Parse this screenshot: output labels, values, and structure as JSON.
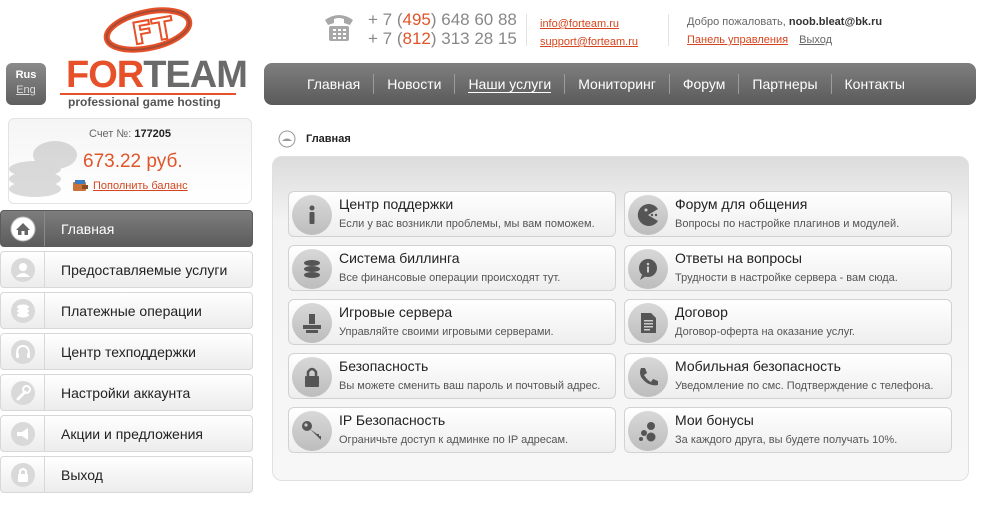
{
  "header": {
    "phones": [
      {
        "prefix": "+ 7 (",
        "code": "495",
        "suffix": ") 648 60 88"
      },
      {
        "prefix": "+ 7 (",
        "code": "812",
        "suffix": ") 313 28 15"
      }
    ],
    "emails": [
      "info@forteam.ru",
      "support@forteam.ru"
    ],
    "welcome": "Добро пожаловать,",
    "user": "noob.bleat@bk.ru",
    "panel_link": "Панель управления",
    "exit_link": "Выход"
  },
  "lang": {
    "active": "Rus",
    "other": "Eng"
  },
  "logo": {
    "part1": "FOR",
    "part2": "TEAM",
    "tagline": "professional game hosting",
    "mark": "FT"
  },
  "nav": {
    "items": [
      "Главная",
      "Новости",
      "Наши услуги",
      "Мониторинг",
      "Форум",
      "Партнеры",
      "Контакты"
    ],
    "active_index": 2
  },
  "account": {
    "label": "Счет №:",
    "number": "177205",
    "balance": "673.22 руб.",
    "topup": "Пополнить баланс"
  },
  "menu": {
    "items": [
      {
        "label": "Главная",
        "icon": "home-icon"
      },
      {
        "label": "Предоставляемые услуги",
        "icon": "user-icon"
      },
      {
        "label": "Платежные операции",
        "icon": "coins-icon"
      },
      {
        "label": "Центр техподдержки",
        "icon": "headset-icon"
      },
      {
        "label": "Настройки аккаунта",
        "icon": "wrench-icon"
      },
      {
        "label": "Акции и предложения",
        "icon": "megaphone-icon"
      },
      {
        "label": "Выход",
        "icon": "lock-icon"
      }
    ],
    "active_index": 0
  },
  "breadcrumb": "Главная",
  "cards": [
    {
      "title": "Центр поддержки",
      "desc": "Если у вас возникли проблемы, мы вам поможем.",
      "icon": "info-icon"
    },
    {
      "title": "Форум для общения",
      "desc": "Вопросы по настройке плагинов и модулей.",
      "icon": "chat-icon"
    },
    {
      "title": "Система биллинга",
      "desc": "Все финансовые операции происходят тут.",
      "icon": "coins-icon"
    },
    {
      "title": "Ответы на вопросы",
      "desc": "Трудности в настройке сервера - вам сюда.",
      "icon": "faq-icon"
    },
    {
      "title": "Игровые сервера",
      "desc": "Управляйте своими игровыми серверами.",
      "icon": "server-icon"
    },
    {
      "title": "Договор",
      "desc": "Договор-оферта на оказание услуг.",
      "icon": "document-icon"
    },
    {
      "title": "Безопасность",
      "desc": "Вы можете сменить ваш пароль и почтовый адрес.",
      "icon": "lock-icon"
    },
    {
      "title": "Мобильная безопасность",
      "desc": "Уведомление по смс. Подтверждение с телефона.",
      "icon": "phone-icon"
    },
    {
      "title": "IP Безопасность",
      "desc": "Ограничьте доступ к админке по IP адресам.",
      "icon": "key-icon"
    },
    {
      "title": "Мои бонусы",
      "desc": "За каждого друга, вы будете получать 10%.",
      "icon": "bonus-icon"
    }
  ]
}
